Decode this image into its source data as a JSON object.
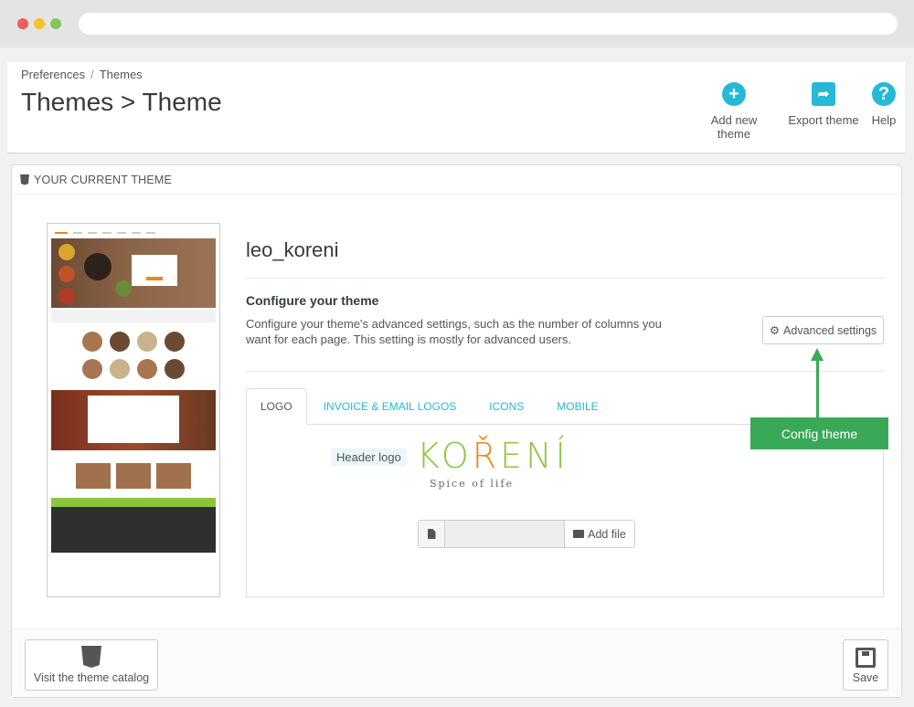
{
  "breadcrumb": {
    "first": "Preferences",
    "separator": "/",
    "second": "Themes"
  },
  "page_title": "Themes > Theme",
  "toolbar": {
    "add_new_theme": {
      "label": "Add new theme",
      "icon": "plus-circle-icon"
    },
    "export_theme": {
      "label": "Export theme",
      "icon": "share-icon"
    },
    "help": {
      "label": "Help",
      "icon": "question-circle-icon"
    }
  },
  "panel": {
    "heading": "YOUR CURRENT THEME",
    "heading_icon": "html5-icon",
    "theme_name": "leo_koreni",
    "configure": {
      "title": "Configure your theme",
      "description": "Configure your theme's advanced settings, such as the number of columns you want for each page. This setting is mostly for advanced users.",
      "button": "Advanced settings",
      "button_icon": "cog-icon"
    },
    "callout": "Config theme",
    "tabs": [
      {
        "label": "LOGO",
        "active": true
      },
      {
        "label": "INVOICE & EMAIL LOGOS",
        "active": false
      },
      {
        "label": "ICONS",
        "active": false
      },
      {
        "label": "MOBILE",
        "active": false
      }
    ],
    "logo": {
      "field_label": "Header logo",
      "brand_part1": "KO",
      "brand_r": "Ř",
      "brand_part2": "ENÍ",
      "tagline": "Spice of life",
      "add_file": "Add file",
      "file_icon": "file-icon",
      "folder_icon": "folder-open-icon"
    },
    "footer": {
      "catalog": "Visit the theme catalog",
      "save": "Save"
    }
  },
  "colors": {
    "accent": "#25b9d7",
    "callout_green": "#39a957",
    "brand_green": "#8cc63e",
    "brand_orange": "#e6891a"
  }
}
